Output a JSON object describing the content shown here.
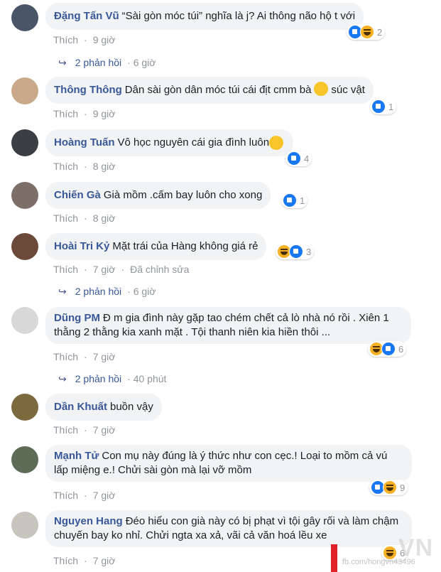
{
  "comments": [
    {
      "author": "Đặng Tấn Vũ",
      "text": "“Sài gòn móc túi” nghĩa là j? Ai thông não hộ t với",
      "like": "Thích",
      "time": "9 giờ",
      "reactions": [
        "like-icon",
        "haha-icon"
      ],
      "reaction_count": "2",
      "replies": {
        "label": "2 phản hồi",
        "time": "6 giờ"
      },
      "avatar_color": "#4a5568"
    },
    {
      "author": "Thông Thông",
      "text": "Dân sài gòn dân móc túi cái địt cmm bà",
      "text_after_emoji": "súc vật",
      "like": "Thích",
      "time": "9 giờ",
      "reactions": [
        "like-icon"
      ],
      "reaction_count": "1",
      "avatar_color": "#c9a98a"
    },
    {
      "author": "Hoàng Tuấn",
      "text": "Vô học nguyên cái gia đình luôn",
      "like": "Thích",
      "time": "8 giờ",
      "reactions": [
        "like-icon"
      ],
      "reaction_count": "4",
      "avatar_color": "#3b3f44"
    },
    {
      "author": "Chiến Gà",
      "text": "Già mồm .cấm bay luôn cho xong",
      "like": "Thích",
      "time": "8 giờ",
      "reactions": [
        "like-icon"
      ],
      "reaction_count": "1",
      "avatar_color": "#7c6f6a"
    },
    {
      "author": "Hoài Tri Kỷ",
      "text": "Mặt trái của Hàng không giá rẻ",
      "like": "Thích",
      "time": "7 giờ",
      "edited": "Đã chỉnh sửa",
      "reactions": [
        "haha-icon",
        "like-icon"
      ],
      "reaction_count": "3",
      "replies": {
        "label": "2 phản hồi",
        "time": "6 giờ"
      },
      "avatar_color": "#6b4a3a"
    },
    {
      "author": "Dũng PM",
      "text": "Đ m gia đình này gặp tao chém chết cả lò nhà nó rồi . Xiên 1 thằng 2 thằng kia xanh mặt . Tội thanh niên kia hiền thôi ...",
      "like": "Thích",
      "time": "7 giờ",
      "reactions": [
        "haha-icon",
        "like-icon"
      ],
      "reaction_count": "6",
      "replies": {
        "label": "2 phản hồi",
        "time": "40 phút"
      },
      "avatar_color": "#d8d8d8"
    },
    {
      "author": "Dần Khuất",
      "text": "buồn vậy",
      "like": "Thích",
      "time": "7 giờ",
      "avatar_color": "#7a6a3e"
    },
    {
      "author": "Mạnh Tử",
      "text": "Con mụ này đúng là ý thức như con cẹc.! Loại to mồm cả vú lấp miệng e.! Chửi sài gòn mà lại vỡ mồm",
      "like": "Thích",
      "time": "7 giờ",
      "reactions": [
        "like-icon",
        "haha-icon"
      ],
      "reaction_count": "9",
      "avatar_color": "#5d6b57"
    },
    {
      "author": "Nguyen Hang",
      "text": "Đéo hiểu con già này có bị phạt vì tội gây rối và làm chậm chuyến bay ko nhỉ. Chửi ngta xa xả, vãi cả văn hoá lều xe",
      "like": "Thích",
      "time": "7 giờ",
      "reactions": [
        "haha-icon"
      ],
      "reaction_count": "6",
      "avatar_color": "#c8c4be"
    }
  ],
  "watermark": {
    "text": "VN",
    "url": "fb.com/hongvn43496"
  }
}
